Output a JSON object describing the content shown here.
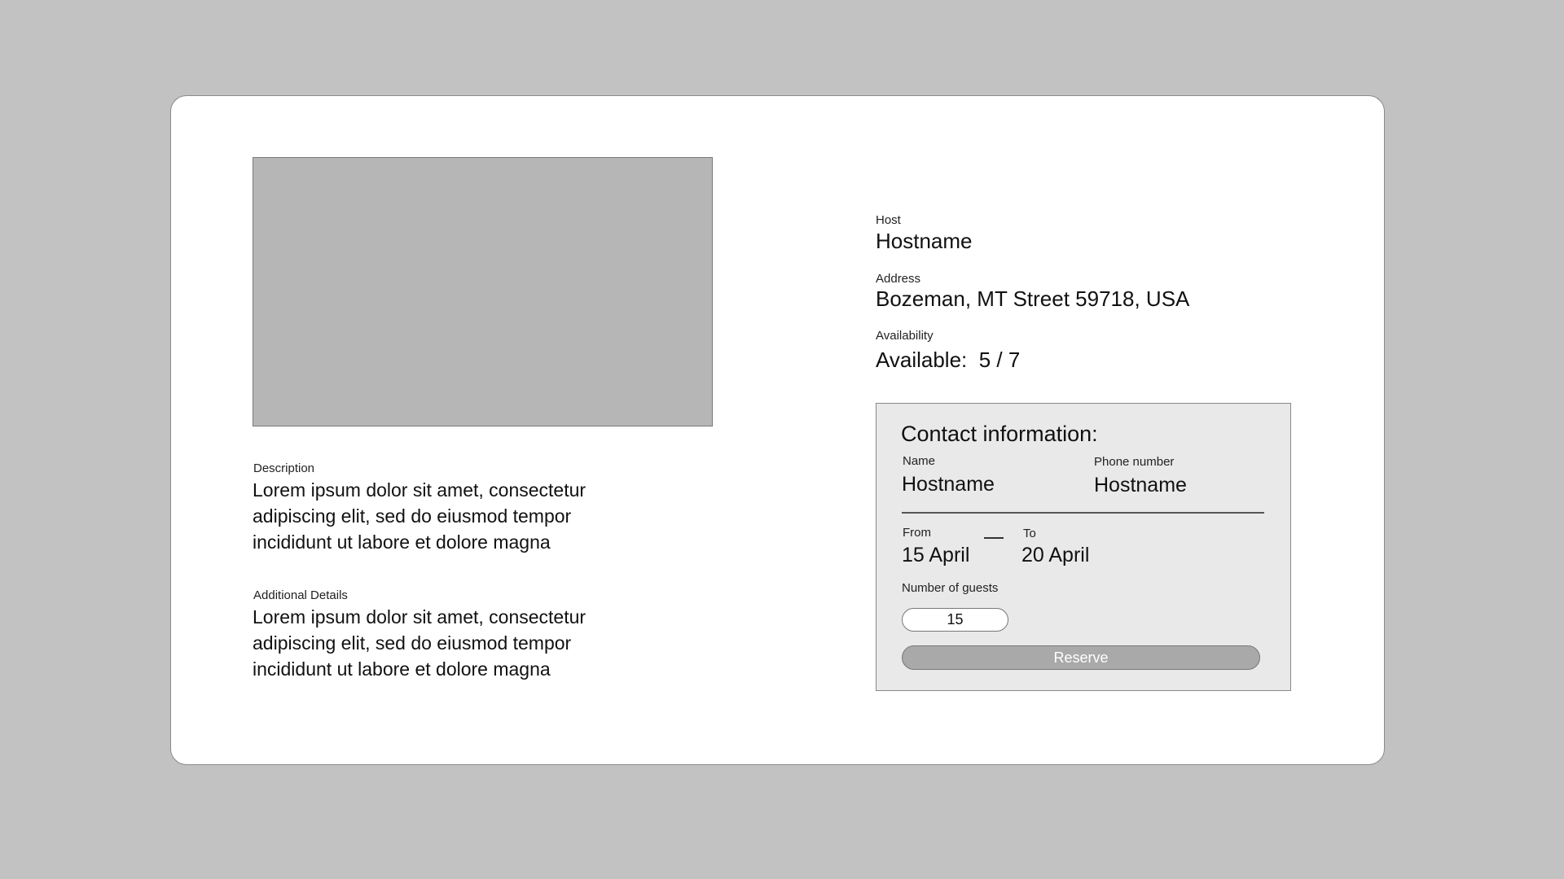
{
  "listing": {
    "description": {
      "label": "Description",
      "text": "Lorem ipsum dolor sit amet, consectetur adipiscing elit, sed do eiusmod tempor incididunt ut labore et dolore magna"
    },
    "additional_details": {
      "label": "Additional Details",
      "text": "Lorem ipsum dolor sit amet, consectetur adipiscing elit, sed do eiusmod tempor incididunt ut labore et dolore magna"
    },
    "host": {
      "label": "Host",
      "value": "Hostname"
    },
    "address": {
      "label": "Address",
      "value": "Bozeman, MT Street 59718, USA"
    },
    "availability": {
      "label": "Availability",
      "value": "Available:  5 / 7"
    }
  },
  "contact": {
    "title": "Contact information:",
    "name": {
      "label": "Name",
      "value": "Hostname"
    },
    "phone": {
      "label": "Phone number",
      "value": "Hostname"
    },
    "from": {
      "label": "From",
      "value": "15 April"
    },
    "to": {
      "label": "To",
      "value": "20 April"
    },
    "guests": {
      "label": "Number of guests",
      "value": "15"
    },
    "reserve_label": "Reserve"
  },
  "colors": {
    "background": "#c2c2c2",
    "card": "#ffffff",
    "image_placeholder": "#b6b6b6",
    "contact_panel": "#e9e9e9",
    "reserve_button": "#a9a9a9"
  }
}
